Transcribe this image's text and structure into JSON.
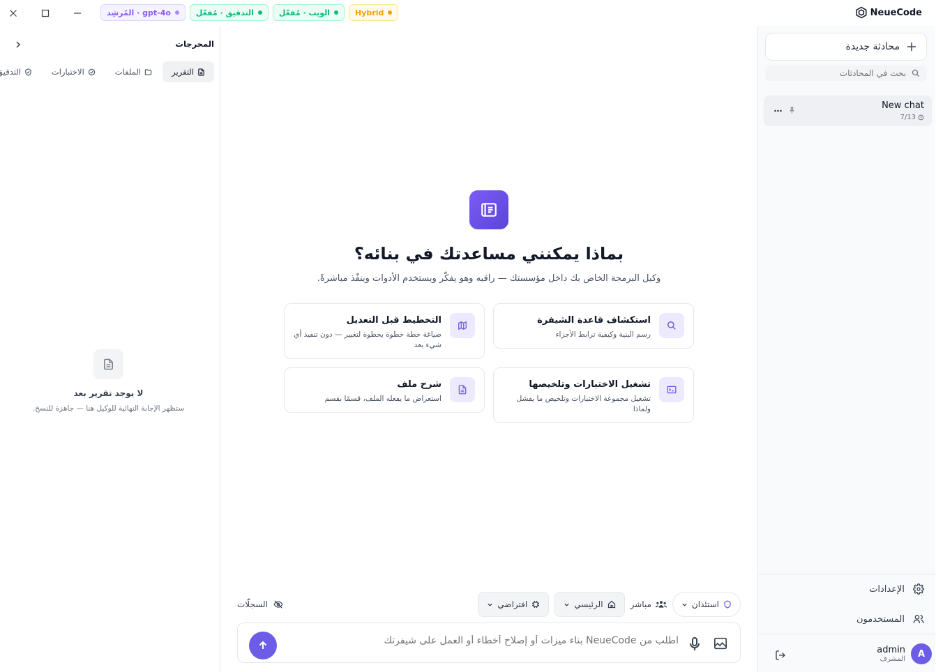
{
  "brand": {
    "name": "NeueCode"
  },
  "status_pills": [
    {
      "label": "Hybrid",
      "color": "#f59e0b"
    },
    {
      "label": "الويب · مُفعّل",
      "color": "#10b981"
    },
    {
      "label": "التدقيق · مُفعّل",
      "color": "#10b981"
    },
    {
      "label": "المُرشِد · gpt-4o",
      "color": "#a78bfa"
    }
  ],
  "sidebar": {
    "new_chat_label": "محادثة جديدة",
    "search_placeholder": "بحث في المحادثات",
    "chats": [
      {
        "title": "New chat",
        "date": "7/13"
      }
    ],
    "settings_label": "الإعدادات",
    "users_label": "المستخدمون",
    "user": {
      "name": "admin",
      "role": "المشرف",
      "initial": "A"
    }
  },
  "main": {
    "headline": "بماذا يمكنني مساعدتك في بنائه؟",
    "subline": "وكيل البرمجة الخاص بك داخل مؤسستك — راقبه وهو يفكّر ويستخدم الأدوات وينفّذ مباشرةً.",
    "cards": [
      {
        "title": "استكشاف قاعدة الشيفرة",
        "desc": "رسم البنية وكيفية ترابط الأجزاء",
        "icon": "search-icon"
      },
      {
        "title": "التخطيط قبل التعديل",
        "desc": "صياغة خطة خطوة بخطوة لتغيير — دون تنفيذ أي شيء بعد",
        "icon": "map-icon"
      },
      {
        "title": "تشغيل الاختبارات وتلخيصها",
        "desc": "تشغيل مجموعة الاختبارات وتلخيص ما يفشل ولماذا",
        "icon": "terminal-icon"
      },
      {
        "title": "شرح ملف",
        "desc": "استعراض ما يفعله الملف، قسمًا بقسم",
        "icon": "file-icon"
      }
    ],
    "controls": {
      "permission": "استئذان",
      "mode": "مباشر",
      "branch": "الرئيسي",
      "model": "افتراضي",
      "logs": "السجلّات"
    },
    "composer_placeholder": "اطلب من NeueCode بناء ميزات أو إصلاح أخطاء أو العمل على شيفرتك"
  },
  "outputs": {
    "title": "المخرجات",
    "tabs": [
      "التقرير",
      "الملفات",
      "الاختبارات",
      "التدقيق"
    ],
    "active_tab": "التقرير",
    "empty_title": "لا يوجد تقرير بعد",
    "empty_desc": "ستظهر الإجابة النهائية للوكيل هنا — جاهزة للنسخ."
  },
  "colors": {
    "accent": "#6d5ce7",
    "accent_soft": "#ede9fe"
  }
}
